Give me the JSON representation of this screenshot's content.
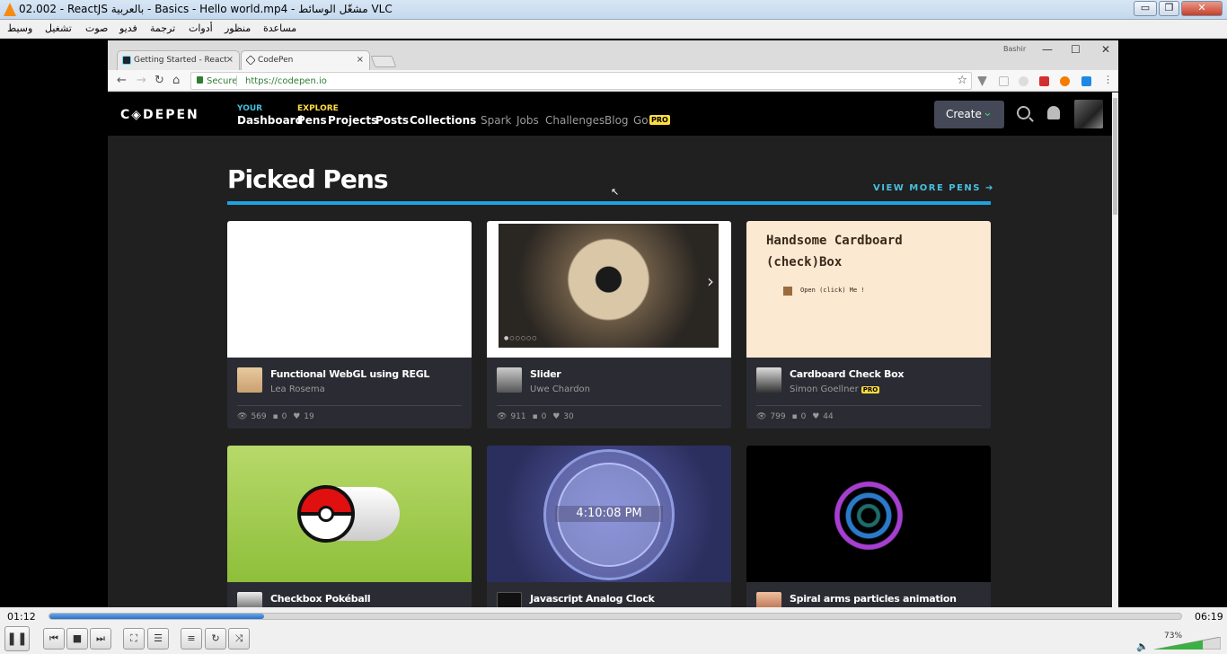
{
  "vlc": {
    "title": "02.002 - ReactJS بالعربية - Basics - Hello world.mp4 - مشغّل الوسائط VLC",
    "menu": [
      "وسيط",
      "تشغيل",
      "صوت",
      "فديو",
      "ترجمة",
      "أدوات",
      "منظور",
      "مساعدة"
    ],
    "window_buttons": {
      "minimize": "▭",
      "restore": "❐",
      "close": "✕"
    },
    "time_elapsed": "01:12",
    "time_total": "06:19",
    "progress_fraction": 0.19,
    "volume": "73%",
    "volume_fraction": 0.73
  },
  "browser": {
    "tabs": [
      {
        "label": "Getting Started - React",
        "close": "×"
      },
      {
        "label": "CodePen",
        "close": "×"
      }
    ],
    "profile": "Bashir",
    "controls": {
      "min": "—",
      "max": "☐",
      "close": "✕"
    },
    "nav": {
      "back": "←",
      "forward": "→",
      "reload": "↻",
      "home": "⌂"
    },
    "secure_label": "Secure",
    "url": "https://codepen.io",
    "star": "☆"
  },
  "codepen": {
    "logo": "C◈DEPEN",
    "your_label": "YOUR",
    "dashboard": "Dashboard",
    "explore_label": "EXPLORE",
    "pens": "Pens",
    "projects": "Projects",
    "posts": "Posts",
    "collections": "Collections",
    "spark": "Spark",
    "jobs": "Jobs",
    "challenges": "Challenges",
    "blog": "Blog",
    "go": "Go",
    "pro": "PRO",
    "create": "Create",
    "section_title": "Picked Pens",
    "view_more": "VIEW MORE PENS ➔",
    "cards": [
      {
        "title": "Functional WebGL using REGL",
        "user": "Lea Rosema",
        "pro": "",
        "views": "569",
        "comments": "0",
        "likes": "19"
      },
      {
        "title": "Slider",
        "user": "Uwe Chardon",
        "pro": "",
        "views": "911",
        "comments": "0",
        "likes": "30"
      },
      {
        "title": "Cardboard Check Box",
        "user": "Simon Goellner",
        "pro": "PRO",
        "views": "799",
        "comments": "0",
        "likes": "44"
      },
      {
        "title": "Checkbox Pokéball"
      },
      {
        "title": "Javascript Analog Clock"
      },
      {
        "title": "Spiral arms particles animation"
      }
    ],
    "cardboard_preview": {
      "title_line1": "Handsome Cardboard",
      "title_line2": "(check)Box",
      "checkbox_label": "Open (click) Me !"
    },
    "clock_time": "4:10:08 PM"
  },
  "colors": {
    "accent": "#1ea2e0",
    "go_pro": "#ffdd40",
    "create_chevron": "#47cf73",
    "vlc_orange": "#f58a12"
  },
  "icons": [
    "vlc-cone-icon",
    "lock-icon",
    "star-icon",
    "search-icon",
    "bell-icon",
    "eye-icon",
    "comment-icon",
    "heart-icon",
    "pause-icon",
    "prev-icon",
    "stop-icon",
    "next-icon",
    "fullscreen-icon",
    "extended-settings-icon",
    "playlist-icon",
    "loop-icon",
    "shuffle-icon",
    "speaker-icon"
  ]
}
